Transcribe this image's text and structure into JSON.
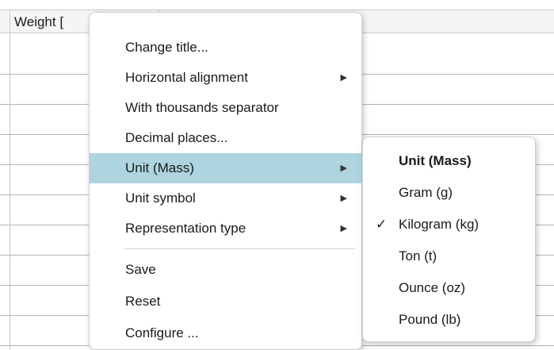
{
  "grid": {
    "column_header": "Weight ["
  },
  "context_menu": {
    "items": [
      {
        "label": "Change title...",
        "submenu": false
      },
      {
        "label": "Horizontal alignment",
        "submenu": true
      },
      {
        "label": "With thousands separator",
        "submenu": false
      },
      {
        "label": "Decimal places...",
        "submenu": false
      },
      {
        "label": "Unit (Mass)",
        "submenu": true,
        "highlighted": true
      },
      {
        "label": "Unit symbol",
        "submenu": true
      },
      {
        "label": "Representation type",
        "submenu": true
      },
      {
        "label": "Save",
        "submenu": false
      },
      {
        "label": "Reset",
        "submenu": false
      },
      {
        "label": "Configure ...",
        "submenu": false
      }
    ],
    "arrow_glyph": "▶",
    "highlight_color": "#aed4e0"
  },
  "unit_submenu": {
    "header": "Unit (Mass)",
    "check_glyph": "✓",
    "options": [
      {
        "label": "Gram (g)",
        "checked": false
      },
      {
        "label": "Kilogram (kg)",
        "checked": true
      },
      {
        "label": "Ton (t)",
        "checked": false
      },
      {
        "label": "Ounce (oz)",
        "checked": false
      },
      {
        "label": "Pound (lb)",
        "checked": false
      }
    ]
  }
}
